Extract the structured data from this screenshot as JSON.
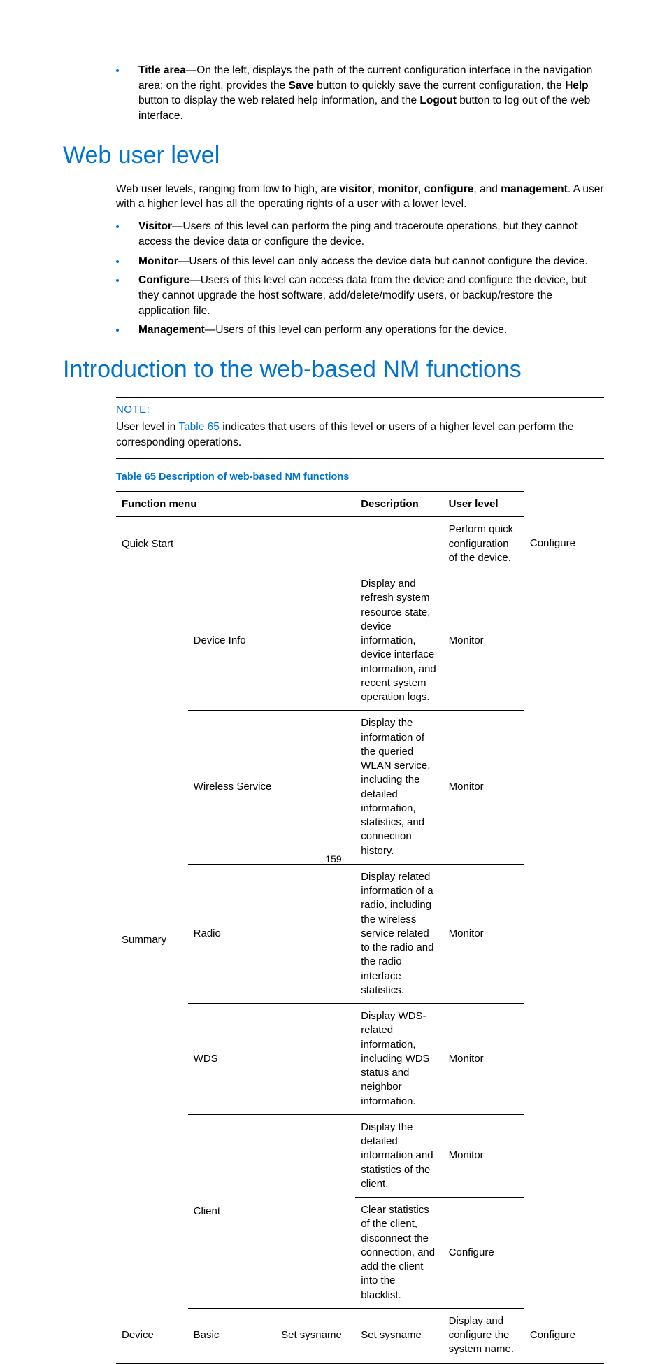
{
  "title_area": {
    "term": "Title area",
    "text_a": "—On the left, displays the path of the current configuration interface in the navigation area; on the right, provides the ",
    "save": "Save",
    "text_b": " button to quickly save the current configuration, the ",
    "help": "Help",
    "text_c": " button to display the web related help information, and the ",
    "logout": "Logout",
    "text_d": " button to log out of the web interface."
  },
  "heading1": "Web user level",
  "levels_para": {
    "a": "Web user levels, ranging from low to high, are ",
    "visitor": "visitor",
    "c1": ", ",
    "monitor": "monitor",
    "c2": ", ",
    "configure": "configure",
    "c3": ", and ",
    "management": "management",
    "b": ". A user with a higher level has all the operating rights of a user with a lower level."
  },
  "bullets": [
    {
      "term": "Visitor",
      "text": "—Users of this level can perform the ping and traceroute operations, but they cannot access the device data or configure the device."
    },
    {
      "term": "Monitor",
      "text": "—Users of this level can only access the device data but cannot configure the device."
    },
    {
      "term": "Configure",
      "text": "—Users of this level can access data from the device and configure the device, but they cannot upgrade the host software, add/delete/modify users, or backup/restore the application file."
    },
    {
      "term": "Management",
      "text": "—Users of this level can perform any operations for the device."
    }
  ],
  "heading2": "Introduction to the web-based NM functions",
  "note": {
    "label": "NOTE:",
    "a": "User level in ",
    "link": "Table 65",
    "b": " indicates that users of this level or users of a higher level can perform the corresponding operations."
  },
  "table_caption": "Table 65 Description of web-based NM functions",
  "table": {
    "headers": {
      "menu": "Function menu",
      "desc": "Description",
      "level": "User level"
    },
    "rows": [
      {
        "a": "Quick Start",
        "b": "",
        "c": "",
        "desc": "Perform quick configuration of the device.",
        "level": "Configure",
        "a_span": 3,
        "a_rb": true,
        "b_span": 0,
        "c_span": 0
      },
      {
        "a": "Summary",
        "b": "Device Info",
        "c": "",
        "desc": "Display and refresh system resource state, device information, device interface information, and recent system operation logs.",
        "level": "Monitor",
        "a_rowspan": 6,
        "a_nb": true,
        "b_span": 2,
        "c_span": 0
      },
      {
        "b": "Wireless Service",
        "c": "",
        "desc": "Display the information of the queried WLAN service, including the detailed information, statistics, and connection history.",
        "level": "Monitor",
        "b_span": 2,
        "c_span": 0
      },
      {
        "b": "Radio",
        "c": "",
        "desc": "Display related information of a radio, including the wireless service related to the radio and the radio interface statistics.",
        "level": "Monitor",
        "b_span": 2,
        "c_span": 0
      },
      {
        "b": "WDS",
        "c": "",
        "desc": "Display WDS-related information, including WDS status and neighbor information.",
        "level": "Monitor",
        "b_span": 2,
        "c_span": 0
      },
      {
        "b": "Client",
        "c": "",
        "desc": "Display the detailed information and statistics of the client.",
        "level": "Monitor",
        "b_rowspan": 2,
        "b_span": 2,
        "c_span": 0
      },
      {
        "desc": "Clear statistics of the client, disconnect the connection, and add the client into the blacklist.",
        "level": "Configure"
      },
      {
        "a": "Device",
        "b": "Basic",
        "c": "Set sysname",
        "desc": "Display and configure the system name.",
        "level": "Configure",
        "a_nb": false
      }
    ]
  },
  "page_number": "159"
}
